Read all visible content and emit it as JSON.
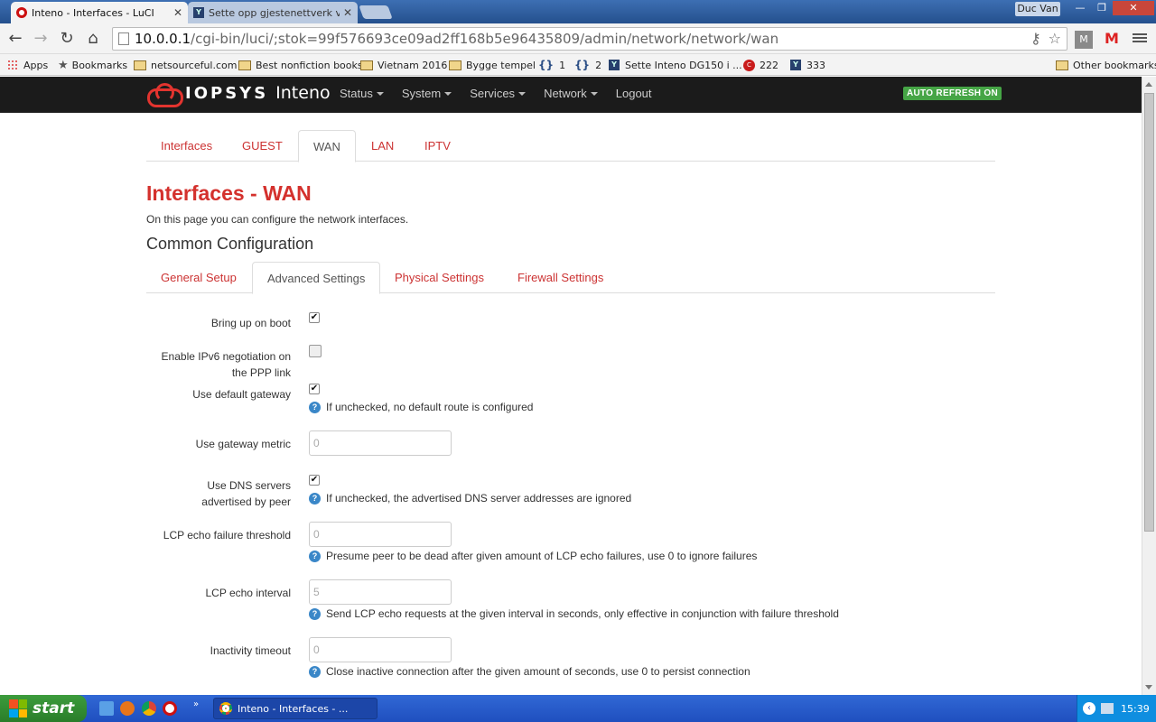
{
  "browser": {
    "tabs": [
      {
        "title": "Inteno - Interfaces - LuCI",
        "active": true
      },
      {
        "title": "Sette opp gjestenettverk vec",
        "active": false
      }
    ],
    "profile": "Duc Van",
    "url_host": "10.0.0.1",
    "url_path": "/cgi-bin/luci/;stok=99f576693ce09ad2ff168b5e96435809/admin/network/network/wan",
    "bookmarks": [
      {
        "label": "Apps",
        "icon": "apps-icon"
      },
      {
        "label": "Bookmarks",
        "icon": "star-icon"
      },
      {
        "label": "netsourceful.com",
        "icon": "folder-icon"
      },
      {
        "label": "Best nonfiction books",
        "icon": "folder-icon"
      },
      {
        "label": "Vietnam 2016",
        "icon": "folder-icon"
      },
      {
        "label": "Bygge tempel",
        "icon": "folder-icon"
      },
      {
        "label": "1",
        "icon": "brace-icon"
      },
      {
        "label": "2",
        "icon": "brace-icon"
      },
      {
        "label": "Sette Inteno DG150 i ...",
        "icon": "router-icon"
      },
      {
        "label": "222",
        "icon": "red-circle-icon"
      },
      {
        "label": "333",
        "icon": "router-icon"
      },
      {
        "label": "Other bookmarks",
        "icon": "folder-icon"
      }
    ]
  },
  "header": {
    "logo_brand": "IOPSYS",
    "logo_product": "Inteno",
    "nav": [
      "Status",
      "System",
      "Services",
      "Network",
      "Logout"
    ],
    "badge": "AUTO REFRESH ON",
    "badge_color": "#46a546"
  },
  "interface_tabs": [
    "Interfaces",
    "GUEST",
    "WAN",
    "LAN",
    "IPTV"
  ],
  "active_interface_tab": "WAN",
  "page": {
    "title": "Interfaces - WAN",
    "description": "On this page you can configure the network interfaces.",
    "section_title": "Common Configuration"
  },
  "settings_tabs": [
    "General Setup",
    "Advanced Settings",
    "Physical Settings",
    "Firewall Settings"
  ],
  "active_settings_tab": "Advanced Settings",
  "form": {
    "bring_up_on_boot": {
      "label": "Bring up on boot",
      "checked": true
    },
    "enable_ipv6": {
      "label_line1": "Enable IPv6 negotiation on",
      "label_line2": "the PPP link",
      "checked": false
    },
    "default_gateway": {
      "label": "Use default gateway",
      "checked": true,
      "help": "If unchecked, no default route is configured"
    },
    "gateway_metric": {
      "label": "Use gateway metric",
      "placeholder": "0"
    },
    "dns_servers": {
      "label_line1": "Use DNS servers",
      "label_line2": "advertised by peer",
      "checked": true,
      "help": "If unchecked, the advertised DNS server addresses are ignored"
    },
    "lcp_failure": {
      "label": "LCP echo failure threshold",
      "placeholder": "0",
      "help": "Presume peer to be dead after given amount of LCP echo failures, use 0 to ignore failures"
    },
    "lcp_interval": {
      "label": "LCP echo interval",
      "placeholder": "5",
      "help": "Send LCP echo requests at the given interval in seconds, only effective in conjunction with failure threshold"
    },
    "inactivity": {
      "label": "Inactivity timeout",
      "placeholder": "0",
      "help": "Close inactive connection after the given amount of seconds, use 0 to persist connection"
    }
  },
  "taskbar": {
    "start_label": "start",
    "task_title": "Inteno - Interfaces - ...",
    "clock": "15:39"
  }
}
